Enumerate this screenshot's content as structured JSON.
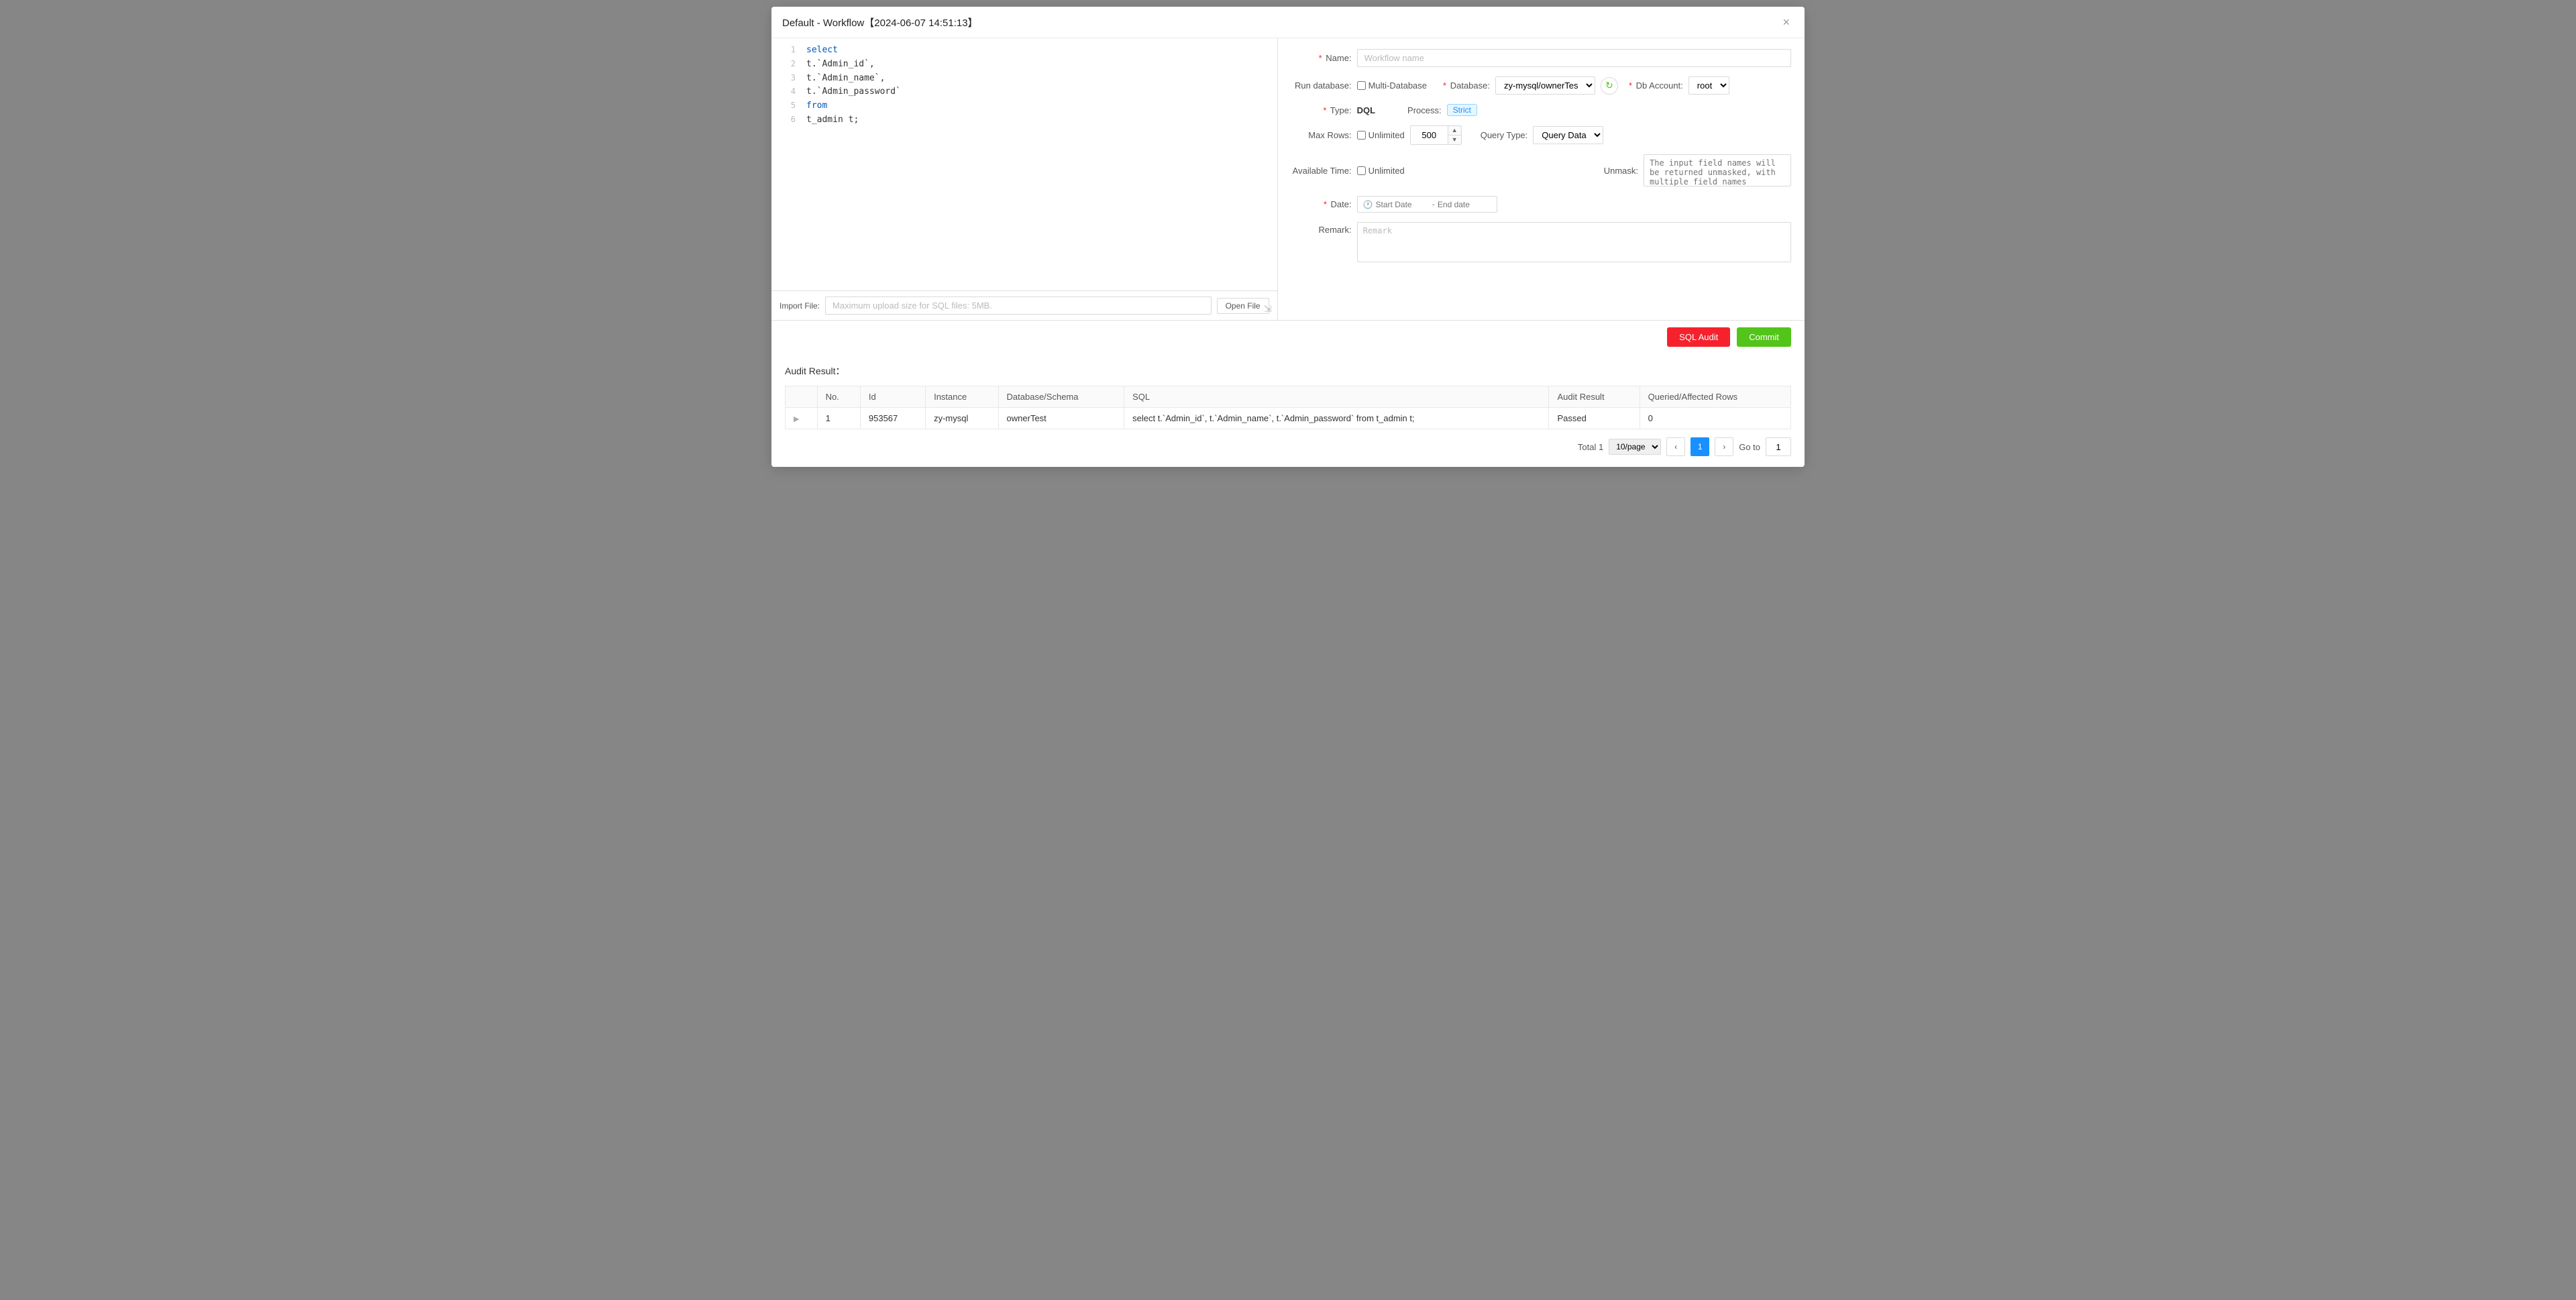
{
  "modal": {
    "title": "Default - Workflow【2024-06-07 14:51:13】",
    "close_label": "×"
  },
  "editor": {
    "lines": [
      {
        "num": 1,
        "content": "select",
        "type": "keyword"
      },
      {
        "num": 2,
        "content": "    t.`Admin_id`,",
        "type": "field"
      },
      {
        "num": 3,
        "content": "    t.`Admin_name`,",
        "type": "field"
      },
      {
        "num": 4,
        "content": "    t.`Admin_password`",
        "type": "field"
      },
      {
        "num": 5,
        "content": "from",
        "type": "keyword"
      },
      {
        "num": 6,
        "content": "    t_admin t;",
        "type": "table"
      }
    ]
  },
  "import_file": {
    "label": "Import File:",
    "placeholder": "Maximum upload size for SQL files: 5MB.",
    "open_file_label": "Open File"
  },
  "form": {
    "name_label": "Name:",
    "name_placeholder": "Workflow name",
    "run_database_label": "Run database:",
    "multi_database_label": "Multi-Database",
    "database_label": "Database:",
    "database_value": "zy-mysql/ownerTes",
    "db_account_label": "Db Account:",
    "db_account_value": "root",
    "type_label": "Type:",
    "type_value": "DQL",
    "process_label": "Process:",
    "process_value": "Strict",
    "max_rows_label": "Max Rows:",
    "unlimited_label": "Unlimited",
    "max_rows_value": "500",
    "query_type_label": "Query Type:",
    "query_type_value": "Query Data",
    "available_time_label": "Available Time:",
    "available_unlimited_label": "Unlimited",
    "unmask_label": "Unmask:",
    "unmask_placeholder": "The input field names will be returned unmasked, with multiple field names separated by commas.",
    "date_label": "Date:",
    "start_date_placeholder": "Start Date",
    "end_date_placeholder": "End date",
    "remark_label": "Remark:",
    "remark_placeholder": "Remark"
  },
  "actions": {
    "sql_audit_label": "SQL Audit",
    "commit_label": "Commit"
  },
  "audit_result": {
    "section_title": "Audit Result：",
    "columns": [
      "No.",
      "Id",
      "Instance",
      "Database/Schema",
      "SQL",
      "Audit Result",
      "Queried/Affected Rows"
    ],
    "rows": [
      {
        "no": "1",
        "id": "953567",
        "instance": "zy-mysql",
        "schema": "ownerTest",
        "sql": "select t.`Admin_id`, t.`Admin_name`, t.`Admin_password` from t_admin t;",
        "audit_result": "Passed",
        "rows": "0"
      }
    ],
    "pagination": {
      "total_label": "Total 1",
      "per_page": "10/page",
      "current_page": "1",
      "goto_label": "Go to",
      "goto_value": "1"
    }
  }
}
